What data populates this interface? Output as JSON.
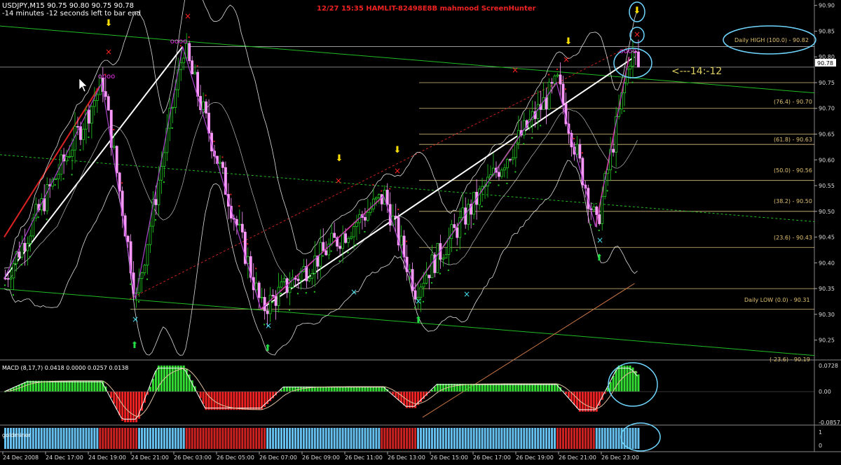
{
  "header": {
    "symbol_line": "USDJPY,M15  90.75 90.80 90.75 90.78",
    "countdown_line": "-14 minutes -12 seconds left to bar end",
    "center_title": "12/27  15:35  HAMLIT-82498E8B  mahmood  ScreenHunter"
  },
  "annotations": {
    "countdown_callout": "<---14:-12",
    "daily_high": "Daily HIGH (100.0) -  90.82",
    "daily_low": "Daily LOW (0.0) -  90.31",
    "fib_764": "(76.4) -  90.70",
    "fib_618": "(61.8) -  90.63",
    "fib_500": "(50.0) -  90.56",
    "fib_382": "(38.2) -  90.50",
    "fib_236": "(23.6) -  90.43",
    "fib_cut": "(-23.6) -  90.19"
  },
  "price_axis": {
    "ticks": [
      "90.90",
      "90.85",
      "90.80",
      "90.75",
      "90.70",
      "90.65",
      "90.60",
      "90.55",
      "90.50",
      "90.45",
      "90.40",
      "90.35",
      "90.30",
      "90.25"
    ],
    "current_price": "90.78"
  },
  "macd": {
    "label": "MACD  (8,17,7) 0.0418 0.0000 0.0257 0.0138",
    "ticks": [
      "0.0728",
      "0.00",
      "-0.0857"
    ]
  },
  "goldminer": {
    "label": "goldminer",
    "ticks": [
      "1",
      "0"
    ]
  },
  "time_axis": {
    "labels": [
      "24 Dec 2008",
      "24 Dec 17:00",
      "24 Dec 19:00",
      "24 Dec 21:00",
      "26 Dec 03:00",
      "26 Dec 05:00",
      "26 Dec 07:00",
      "26 Dec 09:00",
      "26 Dec 11:00",
      "26 Dec 13:00",
      "26 Dec 15:00",
      "26 Dec 17:00",
      "26 Dec 19:00",
      "26 Dec 21:00",
      "26 Dec 23:00"
    ]
  },
  "colors": {
    "background": "#000000",
    "bull_candle": "#22cc22",
    "bear_candle": "#ff99ff",
    "macd_up": "#33dd33",
    "macd_down": "#ee2222",
    "gold_up": "#66c0f0",
    "gold_down": "#cc2222",
    "zigzag": "#aa44cc",
    "fib_line": "#d8c080",
    "callout": "#6fd6ff"
  },
  "chart_data": {
    "type": "candlestick",
    "symbol": "USDJPY",
    "timeframe": "M15",
    "ylim": [
      90.225,
      90.905
    ],
    "macd_ylim": [
      -0.0857,
      0.0728
    ],
    "fib_levels": [
      {
        "ratio": 100.0,
        "price": 90.82
      },
      {
        "ratio": 76.4,
        "price": 90.7
      },
      {
        "ratio": 61.8,
        "price": 90.63
      },
      {
        "ratio": 50.0,
        "price": 90.56
      },
      {
        "ratio": 38.2,
        "price": 90.5
      },
      {
        "ratio": 23.6,
        "price": 90.43
      },
      {
        "ratio": 0.0,
        "price": 90.31
      }
    ],
    "zigzag_points": [
      {
        "bar": 0,
        "price": 90.37
      },
      {
        "bar": 35,
        "price": 90.75
      },
      {
        "bar": 47,
        "price": 90.33
      },
      {
        "bar": 64,
        "price": 90.82
      },
      {
        "bar": 92,
        "price": 90.31
      },
      {
        "bar": 136,
        "price": 90.53
      },
      {
        "bar": 147,
        "price": 90.35
      },
      {
        "bar": 198,
        "price": 90.75
      },
      {
        "bar": 212,
        "price": 90.47
      },
      {
        "bar": 224,
        "price": 90.8
      }
    ],
    "last_close": 90.78
  }
}
